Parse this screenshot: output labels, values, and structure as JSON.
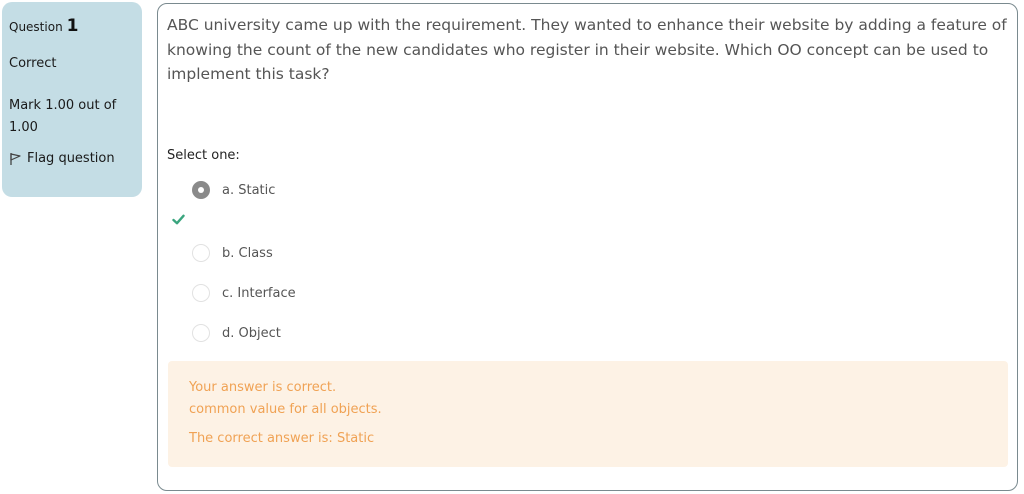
{
  "info": {
    "question_label": "Question",
    "question_number": "1",
    "state": "Correct",
    "grade": "Mark 1.00 out of 1.00",
    "flag_label": "Flag question"
  },
  "question": {
    "text": "ABC university came up with the requirement. They wanted to enhance their website by adding a feature of knowing the count of the new candidates who register in their website. Which OO concept can be used to implement this task?",
    "prompt": "Select one:",
    "options": [
      {
        "label": "a. Static",
        "selected": true
      },
      {
        "label": "b. Class",
        "selected": false
      },
      {
        "label": "c. Interface",
        "selected": false
      },
      {
        "label": "d. Object",
        "selected": false
      }
    ]
  },
  "feedback": {
    "status": "Your answer is correct.",
    "general": "common value for all objects.",
    "right_answer": "The correct answer is: Static"
  },
  "colors": {
    "info_bg": "#c4dde5",
    "feedback_bg": "#fdf2e5",
    "feedback_text": "#f0a254",
    "correct_check": "#3aa57e"
  }
}
